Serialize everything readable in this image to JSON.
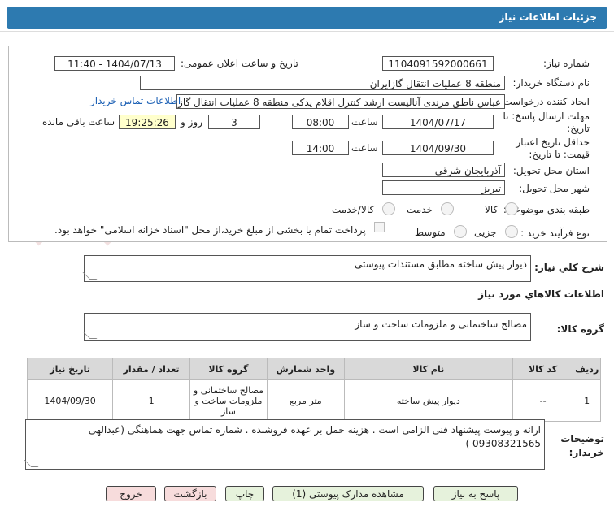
{
  "title": "جزئیات اطلاعات نیاز",
  "labels": {
    "need_number": "شماره نیاز:",
    "announce_datetime": "تاریخ و ساعت اعلان عمومی:",
    "buyer_name": "نام دستگاه خریدار:",
    "requester": "ایجاد کننده درخواست:",
    "reply_deadline": "مهلت ارسال پاسخ: تا تاریخ:",
    "hour": "ساعت",
    "day_and": "روز و",
    "remaining": "ساعت باقی مانده",
    "price_validity": "حداقل تاریخ اعتبار قیمت: تا تاریخ:",
    "province": "استان محل تحویل:",
    "city": "شهر محل تحویل:",
    "category": "طبقه بندی موضوعی:",
    "purchase_type": "نوع فرآیند خرید :",
    "summary": "شرح کلي نياز:",
    "goods_info": "اطلاعات کالاهاي مورد نياز",
    "goods_group": "گروه کالا:",
    "buyer_notes": "توضیحات خریدار:"
  },
  "values": {
    "need_number": "1104091592000661",
    "announce_datetime": "1404/07/13 - 11:40",
    "buyer_name": "منطقه 8 عملیات انتقال گازایران",
    "requester": "عباس ناطق مرندی آنالیست ارشد کنترل اقلام یدکی منطقه 8 عملیات انتقال گازا",
    "contact_link": "اطلاعات تماس خریدار",
    "reply_date": "1404/07/17",
    "reply_time": "08:00",
    "days": "3",
    "remaining_time": "19:25:26",
    "validity_date": "1404/09/30",
    "validity_time": "14:00",
    "province": "آذربایجان شرقی",
    "city": "تبریز",
    "summary": "دیوار پیش ساخته مطابق مستندات پیوستی",
    "goods_group": "مصالح ساختمانی و ملزومات ساخت و ساز",
    "buyer_notes": "ارائه و پیوست پیشنهاد فنی الزامی است . هزینه حمل بر عهده فروشنده . شماره تماس جهت هماهنگی (عبدالهی 09308321565 )"
  },
  "category_options": [
    "کالا",
    "خدمت",
    "کالا/خدمت"
  ],
  "purchase_options": [
    "جزیی",
    "متوسط"
  ],
  "payment_note": "پرداخت تمام یا بخشی از مبلغ خرید،از محل \"اسناد خزانه اسلامی\" خواهد بود.",
  "table": {
    "headers": [
      "ردیف",
      "کد کالا",
      "نام کالا",
      "واحد شمارش",
      "گروه کالا",
      "تعداد / مقدار",
      "تاریخ نیاز"
    ],
    "rows": [
      [
        "1",
        "--",
        "دیوار پیش ساخته",
        "متر مربع",
        "مصالح ساختمانی و ملزومات ساخت و ساز",
        "1",
        "1404/09/30"
      ]
    ]
  },
  "buttons": {
    "reply": "پاسخ به نیاز",
    "view_docs": "مشاهده مدارک پیوستی (1)",
    "print": "چاپ",
    "back": "بازگشت",
    "exit": "خروج"
  },
  "watermark": "AriaTender.net"
}
